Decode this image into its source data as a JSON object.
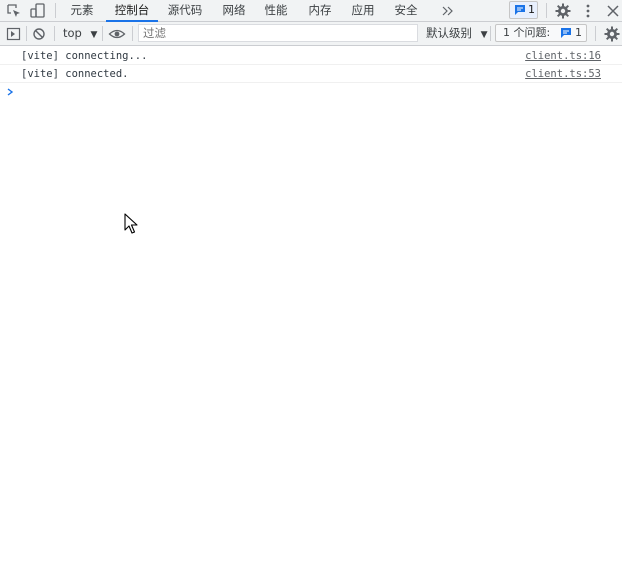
{
  "devtools": {
    "tabs": [
      {
        "label": "元素",
        "active": false
      },
      {
        "label": "控制台",
        "active": true
      },
      {
        "label": "源代码",
        "active": false
      },
      {
        "label": "网络",
        "active": false
      },
      {
        "label": "性能",
        "active": false
      },
      {
        "label": "内存",
        "active": false
      },
      {
        "label": "应用",
        "active": false
      },
      {
        "label": "安全",
        "active": false
      }
    ],
    "more_tabs_icon": "chevron-double-right-icon",
    "issues_badge_count": "1",
    "accent_color": "#1a73e8"
  },
  "console_toolbar": {
    "context": "top",
    "filter_placeholder": "过滤",
    "log_level": "默认级别",
    "issues_label": "1 个问题:",
    "issues_count": "1"
  },
  "console": {
    "messages": [
      {
        "text": "[vite] connecting...",
        "source": "client.ts:16"
      },
      {
        "text": "[vite] connected.",
        "source": "client.ts:53"
      }
    ]
  }
}
